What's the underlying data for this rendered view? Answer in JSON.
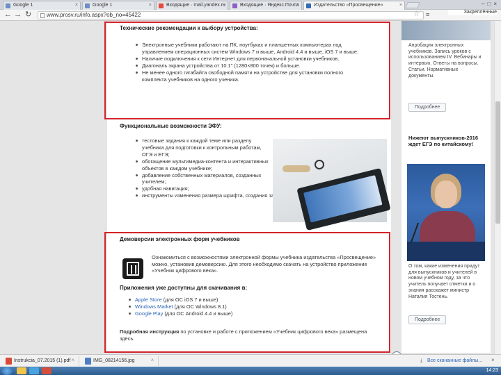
{
  "browser": {
    "tabs": [
      {
        "label": "Google 1",
        "active": false
      },
      {
        "label": "Google 1",
        "active": false
      },
      {
        "label": "Входящие · mail.yandex.ru",
        "active": false
      },
      {
        "label": "Входящие · Яндекс.Почта",
        "active": false
      },
      {
        "label": "Издательство «Просвещение»",
        "active": true
      }
    ],
    "url": "www.prosv.ru/info.aspx?ob_no=45422",
    "side_label": "Закреплённые"
  },
  "main": {
    "sec1_title": "Технические рекомендации к выбору устройства:",
    "sec1_items": [
      "Электронные учебники работают на ПК, ноутбуках и планшетных компьютерах под управлением операционных систем Windows 7 и выше, Android 4.4 и выше, iOS 7 и выше.",
      "Наличие подключения к сети Интернет для первоначальной установки учебников.",
      "Диагональ экрана устройства от 10.1\" (1280×800 точек) и больше.",
      "Не менее одного гигабайта свободной памяти на устройстве для установки полного комплекта учебников на одного ученика."
    ],
    "sec2_title": "Функциональные возможности ЭФУ:",
    "sec2_items": [
      "тестовые задания к каждой теме или разделу учебника для подготовки к контрольным работам, ОГЭ и ЕГЭ;",
      "обогащение мультимедиа-контента и интерактивных объектов в каждом учебнике;",
      "добавление собственных материалов, созданных учителем;",
      "удобная навигация;",
      "инструменты изменения размера шрифта, создания заметок и закладок."
    ],
    "sec3_title": "Демоверсии электронных форм учебников",
    "sec3_para": "Ознакомиться с возможностями электронной формы учебника издательства «Просвещение» можно, установив демоверсию. Для этого необходимо скачать на устройство приложение «Учебник цифрового века».",
    "apps_title": "Приложения уже доступны для скачивания в:",
    "apps": [
      {
        "link": "Apple Store",
        "rest": " (для ОС iOS 7 и выше)"
      },
      {
        "link": "Windows Market",
        "rest": " (для ОС Windows 8.1)"
      },
      {
        "link": "Google Play",
        "rest": " (для ОС Android 4.4 и выше)"
      }
    ],
    "instr_bold": "Подробная инструкция",
    "instr_rest": " по установке и работе с приложением «Учебник цифрового века» размещена здесь."
  },
  "sidebar": {
    "card1_text": "Апробация электронных учебников. Запись уроков с использованием IV. Вебинары и интервью. Ответы на вопросы. Статьи. Нормативные документы.",
    "card1_button": "Подробнее",
    "card2_title": "Нижеют выпускников-2016 ждет ЕГЭ по китайскому!",
    "card2_text": "О том, какие изменения придут для выпускников и учителей в новом учебном году, за что учитель получает отметки и о знания расскажет министр Наталия Тостень.",
    "card2_button": "Подробнее"
  },
  "downloads": {
    "items": [
      {
        "name": "Instrukcia_07.2015 (1).pdf",
        "type": "pdf"
      },
      {
        "name": "IMG_08214156.jpg",
        "type": "img"
      }
    ],
    "show_all": "Все скачанные файлы..."
  },
  "taskbar": {
    "clock": "14:23"
  }
}
